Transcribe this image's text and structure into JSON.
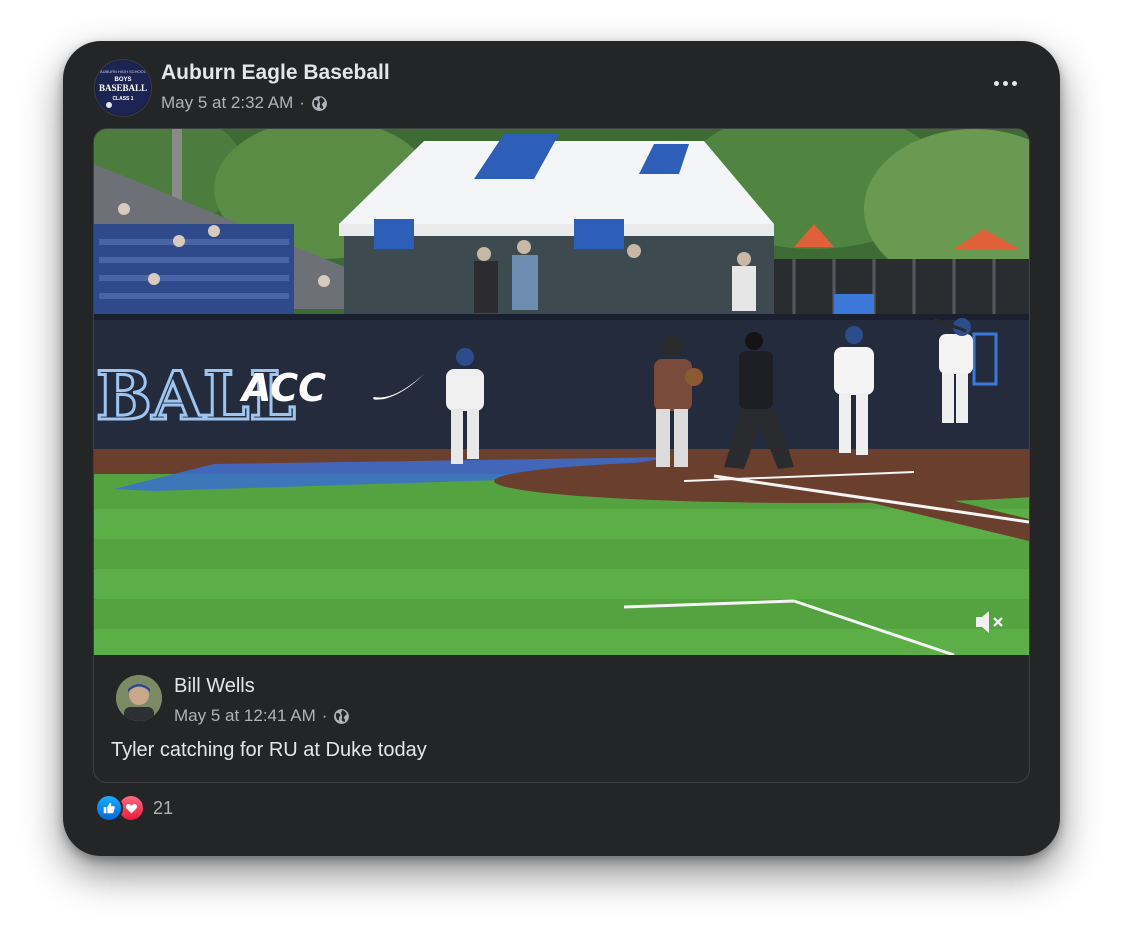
{
  "post": {
    "page_name": "Auburn Eagle Baseball",
    "timestamp": "May 5 at 2:32 AM",
    "separator": "·",
    "avatar_lines": [
      "AUBURN HIGH SCHOOL",
      "BOYS",
      "BASEBALL",
      "CLASS 1"
    ]
  },
  "video": {
    "wall_text": "BALL",
    "sponsor_1": "ACC",
    "muted": true
  },
  "shared_post": {
    "author": "Bill Wells",
    "timestamp": "May 5 at 12:41 AM",
    "separator": "·",
    "caption": "Tyler catching for RU at Duke today"
  },
  "reactions": {
    "types": [
      "like-icon",
      "love-icon"
    ],
    "count": "21"
  },
  "colors": {
    "card_bg": "#242526",
    "primary_text": "#e4e6eb",
    "secondary_text": "#b0b3b8",
    "like_blue": "#0568d8",
    "love_red": "#e61e3c"
  }
}
